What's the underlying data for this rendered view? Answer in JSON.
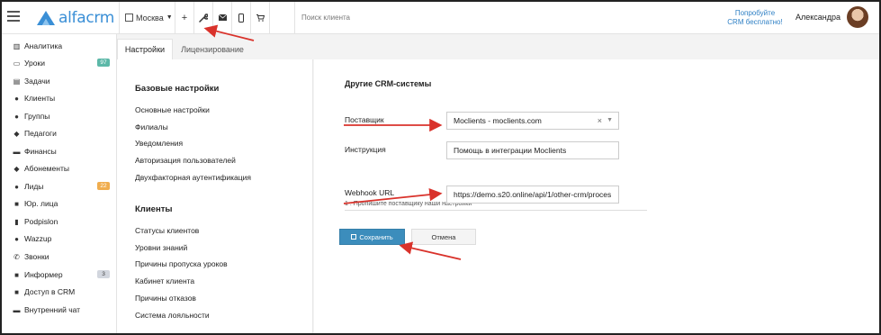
{
  "topbar": {
    "logo_text": "alfacrm",
    "city": "Москва",
    "search_placeholder": "Поиск клиента",
    "promo_line1": "Попробуйте",
    "promo_line2": "CRM бесплатно!",
    "user_name": "Александра",
    "icons": [
      "menu-icon",
      "building-icon",
      "plus-icon",
      "wrench-icon",
      "mail-icon",
      "phone-icon",
      "cart-icon"
    ]
  },
  "sidebar": {
    "items": [
      {
        "label": "Аналитика",
        "icon": "chart-icon"
      },
      {
        "label": "Уроки",
        "icon": "calendar-icon",
        "badge": "97",
        "badge_color": "#5cb8a8"
      },
      {
        "label": "Задачи",
        "icon": "clipboard-icon"
      },
      {
        "label": "Клиенты",
        "icon": "user-icon"
      },
      {
        "label": "Группы",
        "icon": "users-icon"
      },
      {
        "label": "Педагоги",
        "icon": "graduation-cap-icon"
      },
      {
        "label": "Финансы",
        "icon": "money-icon"
      },
      {
        "label": "Абонементы",
        "icon": "tag-icon"
      },
      {
        "label": "Лиды",
        "icon": "user-plus-icon",
        "badge": "22",
        "badge_color": "#f0ad4e"
      },
      {
        "label": "Юр. лица",
        "icon": "briefcase-icon"
      },
      {
        "label": "Podpislon",
        "icon": "file-icon"
      },
      {
        "label": "Wazzup",
        "icon": "whatsapp-icon"
      },
      {
        "label": "Звонки",
        "icon": "phone-icon"
      },
      {
        "label": "Информер",
        "icon": "book-icon",
        "badge": "3",
        "badge_color": "#d2d6de"
      },
      {
        "label": "Доступ в CRM",
        "icon": "lock-icon"
      },
      {
        "label": "Внутренний чат",
        "icon": "chat-icon"
      }
    ]
  },
  "tabs": [
    {
      "label": "Настройки",
      "active": true
    },
    {
      "label": "Лицензирование",
      "active": false
    }
  ],
  "settings_menu": {
    "basic_title": "Базовые настройки",
    "basic_items": [
      "Основные настройки",
      "Филиалы",
      "Уведомления",
      "Авторизация пользователей",
      "Двухфакторная аутентификация"
    ],
    "clients_title": "Клиенты",
    "clients_items": [
      "Статусы клиентов",
      "Уровни знаний",
      "Причины пропуска уроков",
      "Кабинет клиента",
      "Причины отказов",
      "Система лояльности"
    ]
  },
  "form": {
    "title": "Другие CRM-системы",
    "provider_label": "Поставщик",
    "provider_value": "Moclients - moclients.com",
    "instruction_label": "Инструкция",
    "instruction_value": "Помощь в интеграции Moclients",
    "hint": "1 . Пропишите поставщику наши настройки",
    "webhook_label": "Webhook URL",
    "webhook_value": "https://demo.s20.online/api/1/other-crm/proces",
    "save_label": "Сохранить",
    "cancel_label": "Отмена"
  },
  "colors": {
    "brand": "#3a8fd6",
    "primary_button": "#3c8dbc",
    "annotation_arrow": "#d9322b"
  }
}
